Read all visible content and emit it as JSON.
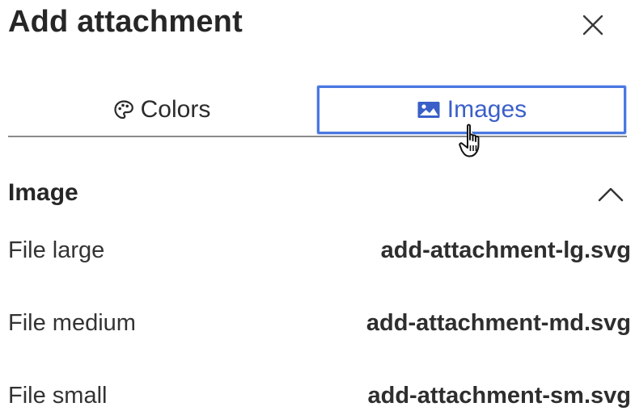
{
  "dialog": {
    "title": "Add attachment",
    "close_icon": "close-icon"
  },
  "tabs": [
    {
      "label": "Colors",
      "icon": "palette-icon",
      "selected": false
    },
    {
      "label": "Images",
      "icon": "image-icon",
      "selected": true
    }
  ],
  "section": {
    "title": "Image",
    "toggle_icon": "chevron-up-icon",
    "rows": [
      {
        "label": "File large",
        "value": "add-attachment-lg.svg"
      },
      {
        "label": "File medium",
        "value": "add-attachment-md.svg"
      },
      {
        "label": "File small",
        "value": "add-attachment-sm.svg"
      }
    ]
  },
  "colors": {
    "accent": "#4a78e0",
    "active_text": "#3a5fc8",
    "text": "#2b2b2b"
  }
}
